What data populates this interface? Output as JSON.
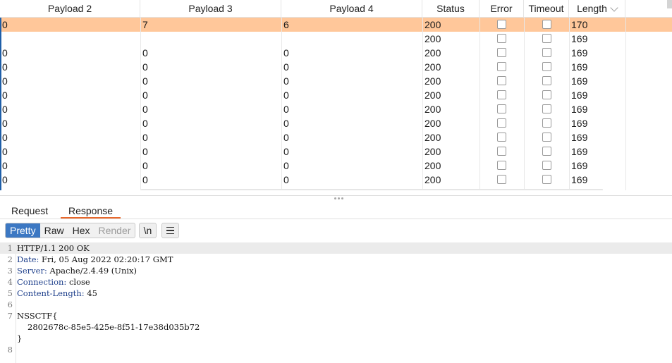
{
  "table": {
    "columns": [
      {
        "label": "Payload 2"
      },
      {
        "label": "Payload 3"
      },
      {
        "label": "Payload 4"
      },
      {
        "label": "Status"
      },
      {
        "label": "Error"
      },
      {
        "label": "Timeout"
      },
      {
        "label": "Length"
      }
    ],
    "sort_icon": "chevron-down-icon",
    "rows": [
      {
        "p2": "0",
        "p3": "7",
        "p4": "6",
        "status": "200",
        "length": "170",
        "selected": true
      },
      {
        "p2": "",
        "p3": "",
        "p4": "",
        "status": "200",
        "length": "169"
      },
      {
        "p2": "0",
        "p3": "0",
        "p4": "0",
        "status": "200",
        "length": "169"
      },
      {
        "p2": "0",
        "p3": "0",
        "p4": "0",
        "status": "200",
        "length": "169"
      },
      {
        "p2": "0",
        "p3": "0",
        "p4": "0",
        "status": "200",
        "length": "169"
      },
      {
        "p2": "0",
        "p3": "0",
        "p4": "0",
        "status": "200",
        "length": "169"
      },
      {
        "p2": "0",
        "p3": "0",
        "p4": "0",
        "status": "200",
        "length": "169"
      },
      {
        "p2": "0",
        "p3": "0",
        "p4": "0",
        "status": "200",
        "length": "169"
      },
      {
        "p2": "0",
        "p3": "0",
        "p4": "0",
        "status": "200",
        "length": "169"
      },
      {
        "p2": "0",
        "p3": "0",
        "p4": "0",
        "status": "200",
        "length": "169"
      },
      {
        "p2": "0",
        "p3": "0",
        "p4": "0",
        "status": "200",
        "length": "169"
      },
      {
        "p2": "0",
        "p3": "0",
        "p4": "0",
        "status": "200",
        "length": "169"
      }
    ],
    "selected_color": "#ffc79a"
  },
  "tabs": {
    "request": "Request",
    "response": "Response",
    "active": "response",
    "accent": "#e8682c"
  },
  "toolbar": {
    "pretty": "Pretty",
    "raw": "Raw",
    "hex": "Hex",
    "render": "Render",
    "newline": "\\n",
    "menu_icon": "hamburger-menu-icon",
    "active": "pretty",
    "accent": "#3c78c3"
  },
  "response": {
    "lines": [
      {
        "n": "1",
        "text": "HTTP/1.1 200 OK"
      },
      {
        "n": "2",
        "key": "Date",
        "value": " Fri, 05 Aug 2022 02:20:17 GMT"
      },
      {
        "n": "3",
        "key": "Server",
        "value": " Apache/2.4.49 (Unix)"
      },
      {
        "n": "4",
        "key": "Connection",
        "value": " close"
      },
      {
        "n": "5",
        "key": "Content-Length",
        "value": " 45"
      },
      {
        "n": "6",
        "text": ""
      },
      {
        "n": "7",
        "text": "NSSCTF{"
      },
      {
        "n": "",
        "text": "2802678c-85e5-425e-8f51-17e38d035b72",
        "indent": true
      },
      {
        "n": "",
        "text": "}"
      },
      {
        "n": "8",
        "text": ""
      }
    ]
  }
}
